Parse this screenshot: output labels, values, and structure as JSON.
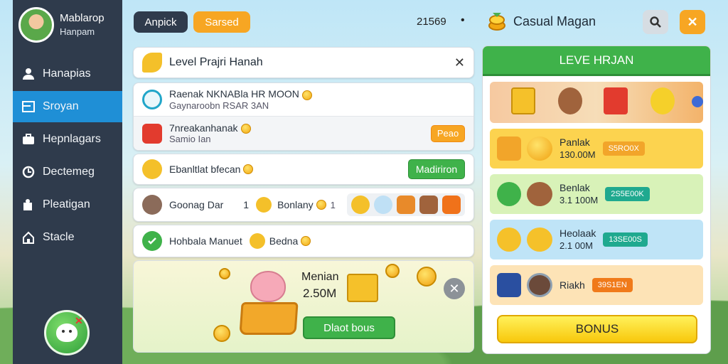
{
  "profile": {
    "name": "Mablarop",
    "subtitle": "Hanpam"
  },
  "sidebar": {
    "items": [
      {
        "label": "Hanapias",
        "icon": "user-icon"
      },
      {
        "label": "Sroyan",
        "icon": "board-icon",
        "active": true
      },
      {
        "label": "Hepnlagars",
        "icon": "briefcase-icon"
      },
      {
        "label": "Dectemeg",
        "icon": "clock-icon"
      },
      {
        "label": "Pleatigan",
        "icon": "puzzle-icon"
      },
      {
        "label": "Stacle",
        "icon": "home-icon"
      }
    ]
  },
  "topbar": {
    "button_a": "Anpick",
    "button_b": "Sarsed",
    "count": "21569",
    "dot": "•",
    "brand": "Casual Magan"
  },
  "list": {
    "header": {
      "title": "Level Prajri Hanah",
      "close": "✕"
    },
    "item1": {
      "title": "Raenak NKNABla HR MOON",
      "sub": "Gaynaroobn RSAR 3AN"
    },
    "item2": {
      "title": "7nreakanhanak",
      "sub": "Samio Ian",
      "tag": "Peao"
    },
    "item3": {
      "title": "Ebanltlat bfecan",
      "button": "Madiriron"
    },
    "item4": {
      "title": "Goonag Dar",
      "count": "1",
      "title2": "Bonlany",
      "count2": "1"
    },
    "item5": {
      "title": "Hohbala Manuet",
      "title2": "Bedna"
    }
  },
  "promo": {
    "title": "Menian",
    "amount": "2.50M",
    "button": "Dlaot bous",
    "close": "✕"
  },
  "right_panel": {
    "header": "LEVE HRJAN",
    "rows": [
      {
        "title": "Panlak",
        "amount": "130.00M",
        "tag": "S5RO0X",
        "color": "#fcd34f",
        "tag_color": "#f2a52a"
      },
      {
        "title": "Benlak",
        "amount": "3.1 100M",
        "tag": "2S5E00K",
        "color": "#d8f2b8",
        "tag_color": "#1fa98f"
      },
      {
        "title": "Heolaak",
        "amount": "2.1 00M",
        "tag": "13SE00S",
        "color": "#bfe4f7",
        "tag_color": "#1fa98f"
      },
      {
        "title": "Riakh",
        "amount": "",
        "tag": "39S1EN",
        "color": "#fde3b6",
        "tag_color": "#f07a1a"
      }
    ],
    "bonus": "BONUS"
  },
  "colors": {
    "sidebar": "#2f3b4c",
    "active": "#1f8fd6",
    "green": "#3fb24a",
    "orange": "#f7a623"
  }
}
